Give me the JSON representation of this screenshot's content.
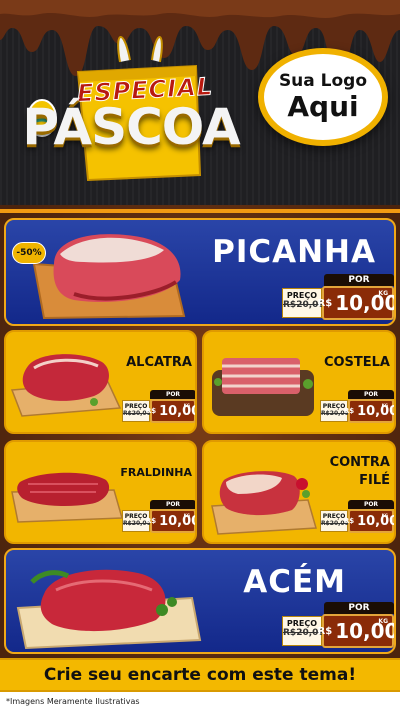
{
  "header": {
    "title_top": "ESPECIAL",
    "title_bottom": "PÁSCOA",
    "logo_line1": "Sua Logo",
    "logo_line2": "Aqui"
  },
  "products": [
    {
      "name": "PICANHA",
      "por": "POR",
      "preco_label": "PREÇO",
      "old_price": "R$20,00",
      "currency": "R$",
      "price": "10,00",
      "unit": "KG",
      "discount": "-50%"
    },
    {
      "name": "ALCATRA",
      "por": "POR",
      "preco_label": "PREÇO",
      "old_price": "R$20,00",
      "currency": "R$",
      "price": "10,00",
      "unit": "KG"
    },
    {
      "name": "COSTELA",
      "por": "POR",
      "preco_label": "PREÇO",
      "old_price": "R$20,00",
      "currency": "R$",
      "price": "10,00",
      "unit": "KG"
    },
    {
      "name": "FRALDINHA",
      "por": "POR",
      "preco_label": "PREÇO",
      "old_price": "R$20,00",
      "currency": "R$",
      "price": "10,00",
      "unit": "KG"
    },
    {
      "name_line1": "CONTRA",
      "name_line2": "FILÉ",
      "por": "POR",
      "preco_label": "PREÇO",
      "old_price": "R$20,00",
      "currency": "R$",
      "price": "10,00",
      "unit": "KG"
    },
    {
      "name": "ACÉM",
      "por": "POR",
      "preco_label": "PREÇO",
      "old_price": "R$20,00",
      "currency": "R$",
      "price": "10,00",
      "unit": "KG"
    }
  ],
  "footer": {
    "text": "Crie seu encarte com este tema!"
  },
  "disclaimer": "*Imagens Meramente Ilustrativas",
  "colors": {
    "blue": "#1c2f96",
    "yellow": "#f2b600",
    "brown": "#5a2c12",
    "price_red": "#8a2b07"
  }
}
